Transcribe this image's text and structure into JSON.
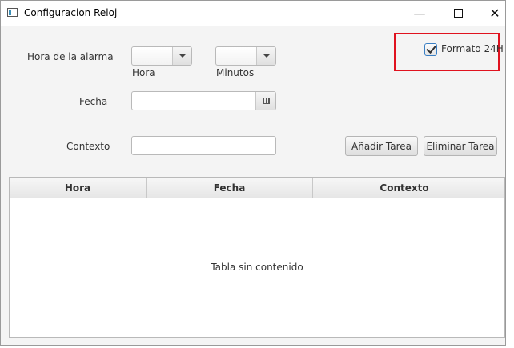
{
  "window": {
    "title": "Configuracion Reloj"
  },
  "controls": {
    "alarm_label": "Hora de la alarma",
    "hour_label": "Hora",
    "minutes_label": "Minutos",
    "date_label": "Fecha",
    "context_label": "Contexto",
    "add_button": "Añadir Tarea",
    "delete_button": "Eliminar Tarea",
    "format_checkbox": {
      "label": "Formato 24H",
      "checked": true
    }
  },
  "table": {
    "columns": [
      "Hora",
      "Fecha",
      "Contexto"
    ],
    "placeholder": "Tabla sin contenido"
  },
  "colors": {
    "highlight": "#e0121f",
    "accent": "#3a7fc4"
  }
}
